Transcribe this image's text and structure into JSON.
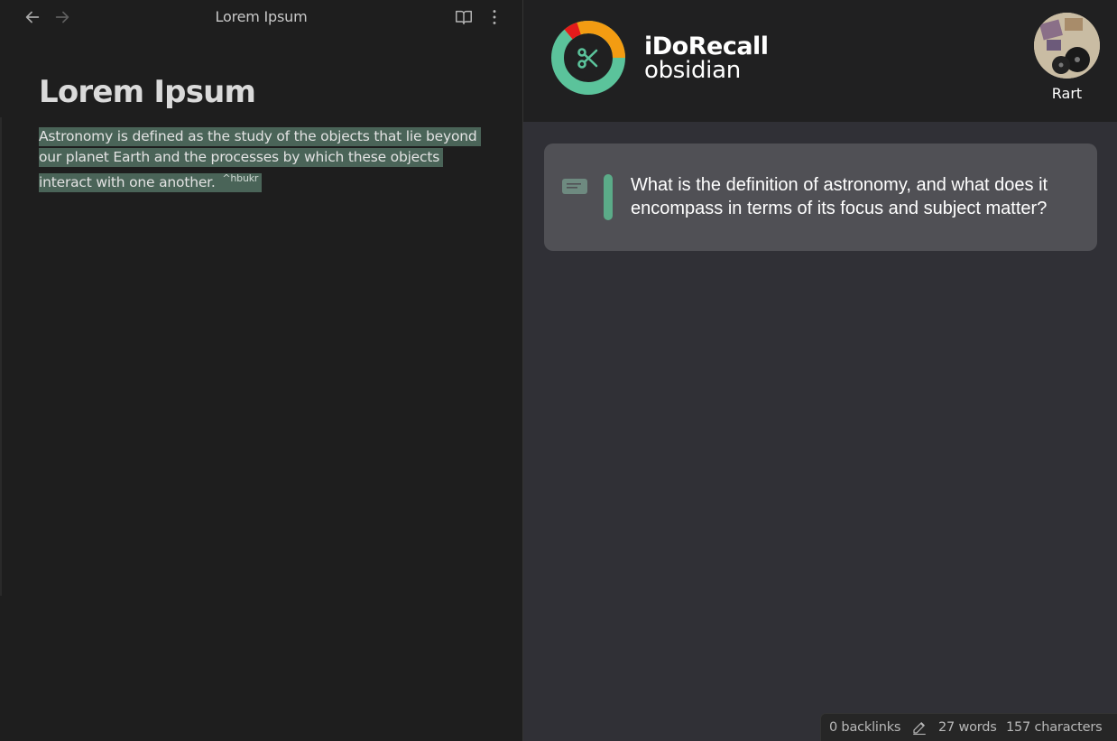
{
  "note_tab": {
    "title": "Lorem Ipsum",
    "back_icon": "arrow-left-icon",
    "forward_icon": "arrow-right-icon",
    "reading_view_icon": "book-open-icon",
    "more_options_icon": "more-vertical-icon"
  },
  "note": {
    "heading": "Lorem Ipsum",
    "paragraph": "Astronomy is defined as the study of the objects that lie beyond our planet Earth and the processes by which these objects interact with one another.",
    "block_id": "^hbukr",
    "highlight_color": "#4a6458"
  },
  "plugin": {
    "brand_name": "iDoRecall",
    "brand_sub": "obsidian",
    "logo_icon": "scissors-donut-logo-icon",
    "user_name": "Rart",
    "logo_colors": {
      "green": "#5bc39b",
      "orange": "#f39c12",
      "red": "#e51b1b"
    }
  },
  "recall_card": {
    "question": "What is the definition of astronomy, and what does it encompass in terms of its focus and subject matter?",
    "card_icon": "message-icon",
    "accent_color": "#5bab88"
  },
  "status_bar": {
    "backlinks": "0 backlinks",
    "edit_icon": "pencil-icon",
    "words": "27 words",
    "characters": "157 characters"
  }
}
